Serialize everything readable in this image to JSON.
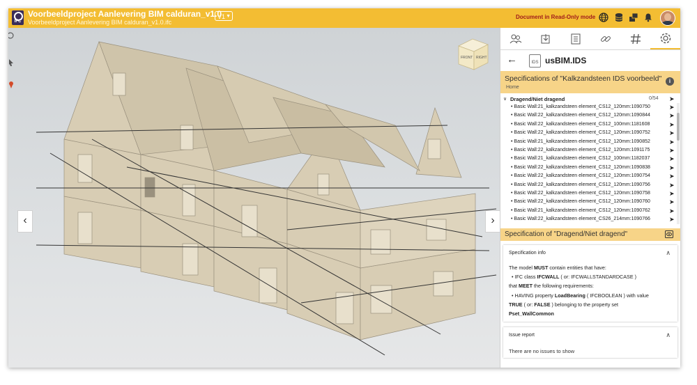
{
  "header": {
    "title": "Voorbeeldproject Aanlevering BIM calduran_v1.0",
    "subtitle": "Voorbeeldproject Aanlevering BIM calduran_v1.0.ifc",
    "logo_text": "IFC",
    "version": "V1",
    "readonly_text": "Document in Read-Only mode",
    "icons": [
      "globe-icon",
      "database-icon",
      "layers-icon",
      "bell-icon",
      "user-avatar"
    ]
  },
  "viewer": {
    "cube_front": "FRONT",
    "cube_right": "RIGHT",
    "nav_left": "‹",
    "nav_right": "›"
  },
  "panel": {
    "tabs": [
      "users-icon",
      "upload-icon",
      "document-icon",
      "link-icon",
      "hash-icon",
      "settings-icon"
    ],
    "active_tab": 5,
    "ids_badge": "IDS",
    "ids_title": "usBIM.IDS",
    "spec_title": "Specifications of \"Kalkzandsteen IDS voorbeeld\"",
    "breadcrumb": "Home",
    "group": {
      "label": "Dragend/Niet dragend",
      "count": "0/54"
    },
    "items": [
      "Basic Wall:21_kalkzandsteen element_CS12_120mm:1090750",
      "Basic Wall:22_kalkzandsteen element_CS12_120mm:1090844",
      "Basic Wall:22_kalkzandsteen element_CS12_100mm:1181608",
      "Basic Wall:22_kalkzandsteen element_CS12_120mm:1090752",
      "Basic Wall:21_kalkzandsteen element_CS12_120mm:1090852",
      "Basic Wall:22_kalkzandsteen element_CS12_120mm:1091175",
      "Basic Wall:21_kalkzandsteen element_CS12_100mm:1182037",
      "Basic Wall:22_kalkzandsteen element_CS12_120mm:1090838",
      "Basic Wall:22_kalkzandsteen element_CS12_120mm:1090754",
      "Basic Wall:22_kalkzandsteen element_CS12_120mm:1090756",
      "Basic Wall:22_kalkzandsteen element_CS12_120mm:1090758",
      "Basic Wall:22_kalkzandsteen element_CS12_120mm:1090760",
      "Basic Wall:21_kalkzandsteen element_CS12_120mm:1090762",
      "Basic Wall:22_kalkzandsteen element_CS26_214mm:1090766"
    ],
    "spec2_title": "Specification of \"Dragend/Niet dragend\"",
    "spec_info": {
      "heading": "Specification info",
      "l1_pre": "The model ",
      "l1_bold": "MUST",
      "l1_post": " contain entities that have:",
      "l2_pre": "• IFC class ",
      "l2_bold": "IFCWALL",
      "l2_post": " ( or: IFCWALLSTANDARDCASE )",
      "l3_pre": "that ",
      "l3_bold": "MEET",
      "l3_post": " the following requirements:",
      "l4_pre": "• HAVING property ",
      "l4_bold": "LoadBearing",
      "l4_post": " ( IFCBOOLEAN ) with value",
      "l5_bold": "TRUE",
      "l5_mid": " ( or: ",
      "l5_bold2": "FALSE",
      "l5_post": " ) belonging to the property set",
      "l6_bold": "Pset_WallCommon"
    },
    "issue_report": {
      "heading": "Issue report",
      "text": "There are no issues to show"
    }
  },
  "colors": {
    "accent": "#f3bd33",
    "spec_bar": "#f7d488",
    "readonly": "#a01b1b",
    "wall": "#d8cdb4"
  }
}
